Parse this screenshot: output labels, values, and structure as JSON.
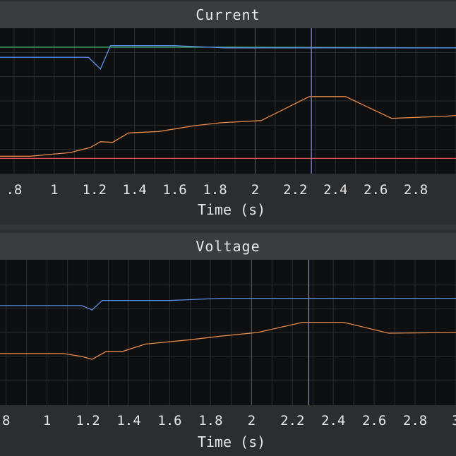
{
  "colors": {
    "blue": "#5b8ee6",
    "green": "#4fc07a",
    "orange": "#e8884a",
    "red": "#d45555",
    "cursor": "#8a7fe6",
    "plot_bg": "#0e0f10",
    "grid": "#2a2c2e",
    "gridline_major": "#5a5c5e"
  },
  "chart_data": [
    {
      "type": "line",
      "title": "Current",
      "xlabel": "Time (s)",
      "ylabel": "",
      "xlim": [
        0.73,
        3.0
      ],
      "ylim": [
        0,
        1
      ],
      "xticks": [
        0.8,
        1,
        1.2,
        1.4,
        1.6,
        1.8,
        2,
        2.2,
        2.4,
        2.6,
        2.8
      ],
      "xtick_labels": [
        ".8",
        "1",
        "1.2",
        "1.4",
        "1.6",
        "1.8",
        "2",
        "2.2",
        "2.4",
        "2.6",
        "2.8"
      ],
      "cursor_x": 2.28,
      "series": [
        {
          "color": "green",
          "x": [
            0.73,
            1.8,
            3.0
          ],
          "y": [
            0.87,
            0.87,
            0.865
          ]
        },
        {
          "color": "blue",
          "x": [
            0.73,
            1.17,
            1.23,
            1.28,
            1.6,
            1.85,
            2.2,
            3.0
          ],
          "y": [
            0.8,
            0.8,
            0.72,
            0.88,
            0.88,
            0.865,
            0.865,
            0.865
          ]
        },
        {
          "color": "orange",
          "x": [
            0.73,
            0.88,
            1.08,
            1.18,
            1.23,
            1.29,
            1.37,
            1.52,
            1.7,
            1.83,
            2.03,
            2.27,
            2.45,
            2.68,
            2.95,
            3.0
          ],
          "y": [
            0.12,
            0.12,
            0.145,
            0.18,
            0.22,
            0.215,
            0.28,
            0.29,
            0.33,
            0.35,
            0.365,
            0.53,
            0.53,
            0.38,
            0.395,
            0.4
          ]
        },
        {
          "color": "red",
          "x": [
            0.73,
            3.0
          ],
          "y": [
            0.105,
            0.105
          ]
        }
      ]
    },
    {
      "type": "line",
      "title": "Voltage",
      "xlabel": "Time (s)",
      "ylabel": "",
      "xlim": [
        0.77,
        3.0
      ],
      "ylim": [
        0,
        1
      ],
      "xticks": [
        0.8,
        1,
        1.2,
        1.4,
        1.6,
        1.8,
        2,
        2.2,
        2.4,
        2.6,
        2.8,
        3.0
      ],
      "xtick_labels": [
        "8",
        "1",
        "1.2",
        "1.4",
        "1.6",
        "1.8",
        "2",
        "2.2",
        "2.4",
        "2.6",
        "2.8",
        "3"
      ],
      "cursor_x": 2.28,
      "series": [
        {
          "color": "blue",
          "x": [
            0.77,
            1.17,
            1.22,
            1.27,
            1.6,
            1.85,
            2.2,
            3.0
          ],
          "y": [
            0.685,
            0.685,
            0.655,
            0.72,
            0.72,
            0.735,
            0.735,
            0.735
          ]
        },
        {
          "color": "orange",
          "x": [
            0.77,
            1.08,
            1.17,
            1.22,
            1.29,
            1.37,
            1.48,
            1.7,
            1.85,
            2.03,
            2.25,
            2.45,
            2.67,
            3.0
          ],
          "y": [
            0.355,
            0.355,
            0.335,
            0.315,
            0.37,
            0.37,
            0.42,
            0.45,
            0.475,
            0.5,
            0.57,
            0.57,
            0.495,
            0.5
          ]
        }
      ]
    }
  ]
}
